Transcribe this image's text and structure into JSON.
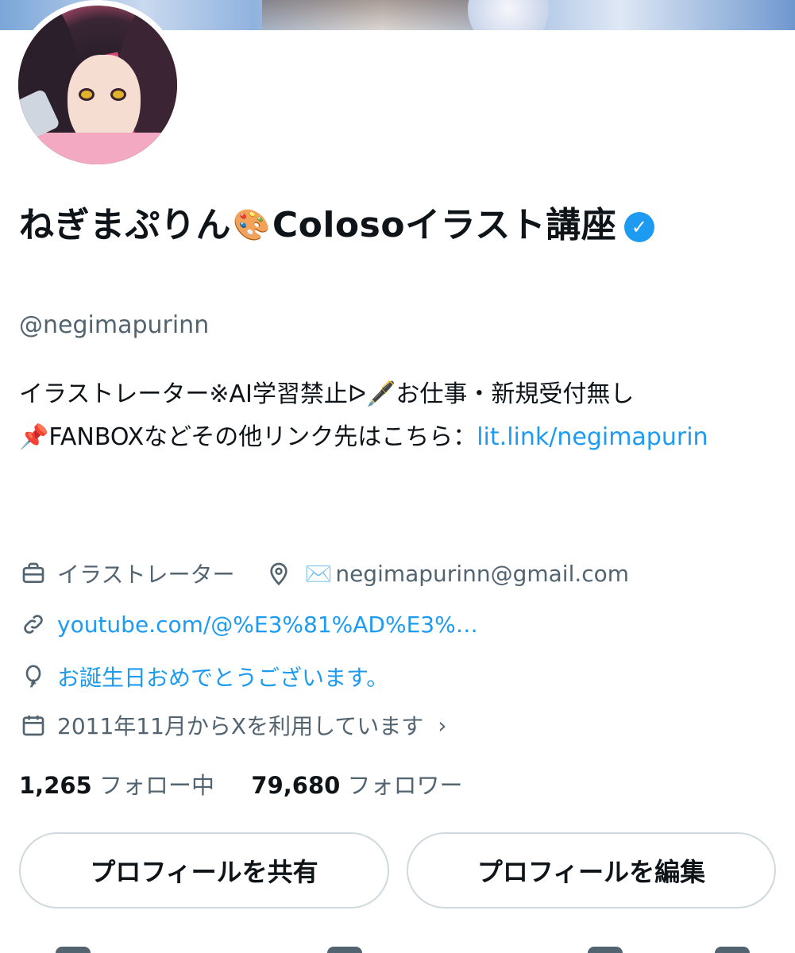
{
  "banner": {
    "description_icon": "header-banner"
  },
  "profile": {
    "display_name_part1": "ねぎまぷりん",
    "display_name_emoji": "🎨",
    "display_name_part2": "Colosoイラスト講座",
    "verified_icon": "verified-badge-icon",
    "handle": "@negimapurinn"
  },
  "bio": {
    "line1": "イラストレーター※AI学習禁止ᐅ🖋️お仕事・新規受付無し",
    "line2_prefix": "📌FANBOXなどその他リンク先はこちら：",
    "line2_link": "lit.link/negimapurin"
  },
  "meta": {
    "profession": "イラストレーター",
    "location_emoji": "✉️",
    "location": "negimapurinn@gmail.com",
    "website": "youtube.com/@%E3%81%AD%E3%%E3%…",
    "website_display": "youtube.com/@%E3%81%AD%E3%…",
    "birthday": "お誕生日おめでとうございます。",
    "joined": "2011年11月からXを利用しています",
    "chevron": "›"
  },
  "stats": {
    "following_count": "1,265",
    "following_label": "フォロー中",
    "followers_count": "79,680",
    "followers_label": "フォロワー"
  },
  "buttons": {
    "share_label": "プロフィールを共有",
    "edit_label": "プロフィールを編集"
  },
  "colors": {
    "text": "#0f1419",
    "secondary": "#536471",
    "link": "#1d9bf0",
    "border": "#cfd9de"
  }
}
